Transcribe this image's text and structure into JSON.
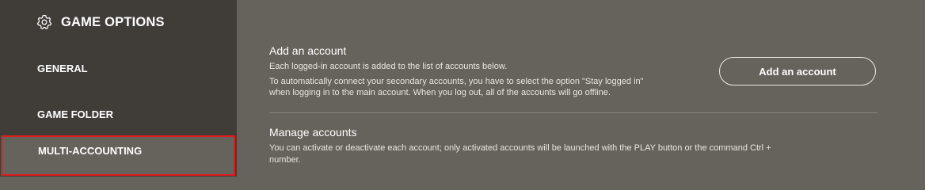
{
  "sidebar": {
    "title": "GAME OPTIONS",
    "title_icon": "gear-icon",
    "items": [
      {
        "label": "GENERAL"
      },
      {
        "label": "GAME FOLDER"
      },
      {
        "label": "MULTI-ACCOUNTING",
        "selected": true
      }
    ]
  },
  "add_account": {
    "title": "Add an account",
    "desc_line1": "Each logged-in account is added to the list of accounts below.",
    "desc_line2": "To automatically connect your secondary accounts, you have to select the option \"Stay logged in\"",
    "desc_line3": "when logging in to the main account. When you log out, all of the accounts will go offline.",
    "button_label": "Add an account"
  },
  "manage_accounts": {
    "title": "Manage accounts",
    "desc_line1": "You can activate or deactivate each account; only activated accounts will be launched with the PLAY button or the command Ctrl +",
    "desc_line2": "number."
  },
  "colors": {
    "sidebar_bg": "#403d39",
    "content_bg": "#66625c",
    "selected_outline": "#e01b1b"
  }
}
